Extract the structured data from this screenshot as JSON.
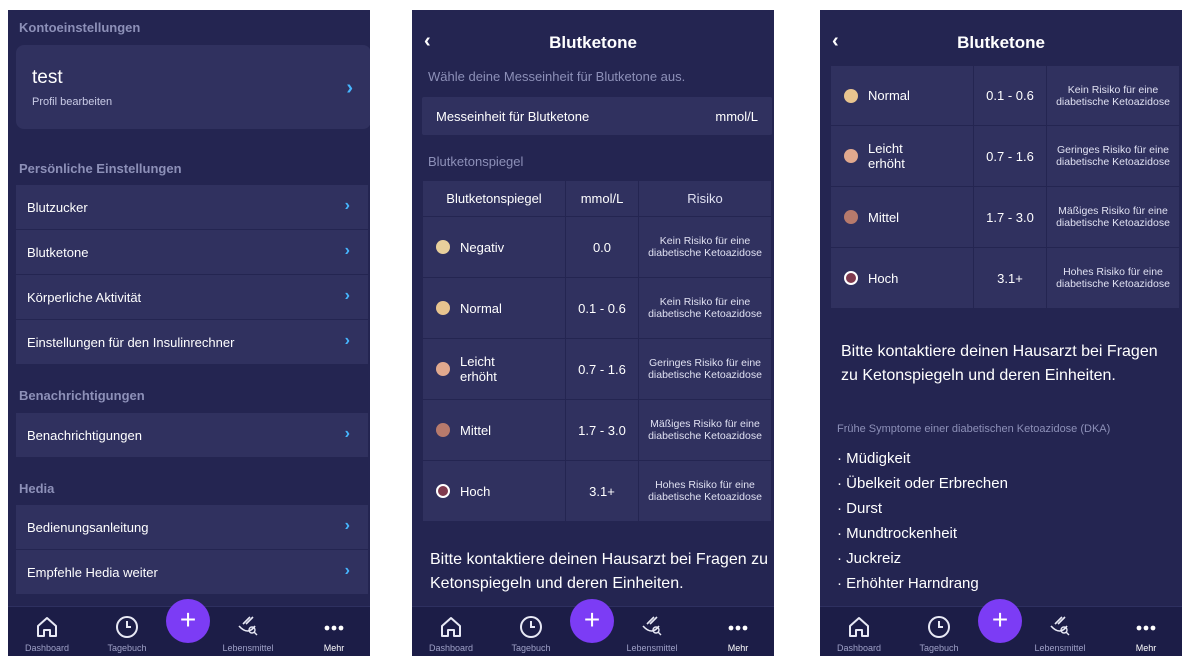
{
  "screen1": {
    "account_header": "Kontoeinstellungen",
    "profile_name": "test",
    "profile_sub": "Profil bearbeiten",
    "personal_header": "Persönliche Einstellungen",
    "personal_items": [
      "Blutzucker",
      "Blutketone",
      "Körperliche Aktivität",
      "Einstellungen für den Insulinrechner"
    ],
    "notif_header": "Benachrichtigungen",
    "notif_items": [
      "Benachrichtigungen"
    ],
    "hedia_header": "Hedia",
    "hedia_items": [
      "Bedienungsanleitung",
      "Empfehle Hedia weiter"
    ]
  },
  "screen2": {
    "title": "Blutketone",
    "intro": "Wähle deine Messeinheit für Blutketone aus.",
    "unit_label": "Messeinheit für Blutketone",
    "unit_value": "mmol/L",
    "table_header_section": "Blutketonspiegel",
    "columns": [
      "Blutketonspiegel",
      "mmol/L",
      "Risiko"
    ],
    "rows": [
      {
        "level": "Negativ",
        "value": "0.0",
        "risk": "Kein Risiko für eine diabetische Ketoazidose",
        "color": "#e8cf9c"
      },
      {
        "level": "Normal",
        "value": "0.1 - 0.6",
        "risk": "Kein Risiko für eine diabetische Ketoazidose",
        "color": "#e8c48f"
      },
      {
        "level": "Leicht erhöht",
        "value": "0.7 - 1.6",
        "risk": "Geringes Risiko für eine diabetische Ketoazidose",
        "color": "#e1a98e"
      },
      {
        "level": "Mittel",
        "value": "1.7 - 3.0",
        "risk": "Mäßiges Risiko für eine diabetische Ketoazidose",
        "color": "#b77a6c"
      },
      {
        "level": "Hoch",
        "value": "3.1+",
        "risk": "Hohes Risiko für eine diabetische Ketoazidose",
        "color": "#7f3a4e"
      }
    ],
    "note": "Bitte kontaktiere deinen Hausarzt bei Fragen zu Ketonspiegeln und deren Einheiten."
  },
  "screen3": {
    "title": "Blutketone",
    "rows": [
      {
        "level": "Normal",
        "value": "0.1 - 0.6",
        "risk": "Kein Risiko für eine diabetische Ketoazidose",
        "color": "#e8c48f"
      },
      {
        "level": "Leicht erhöht",
        "value": "0.7 - 1.6",
        "risk": "Geringes Risiko für eine diabetische Ketoazidose",
        "color": "#e1a98e"
      },
      {
        "level": "Mittel",
        "value": "1.7 - 3.0",
        "risk": "Mäßiges Risiko für eine diabetische Ketoazidose",
        "color": "#b77a6c"
      },
      {
        "level": "Hoch",
        "value": "3.1+",
        "risk": "Hohes Risiko für eine diabetische Ketoazidose",
        "color": "#7f3a4e"
      }
    ],
    "note": "Bitte kontaktiere deinen Hausarzt bei Fragen zu Ketonspiegeln und deren Einheiten.",
    "dka_title": "Frühe Symptome einer diabetischen Ketoazidose (DKA)",
    "symptoms": [
      "· Müdigkeit",
      "· Übelkeit oder Erbrechen",
      "· Durst",
      "· Mundtrockenheit",
      "· Juckreiz",
      "· Erhöhter Harndrang"
    ]
  },
  "nav": {
    "items": [
      "Dashboard",
      "Tagebuch",
      "Lebensmittel",
      "Mehr"
    ],
    "add_symbol": "+",
    "accent": "#7c3cf5",
    "active": "Mehr"
  },
  "icons": {
    "back": "‹",
    "chevron": "›"
  },
  "colors": {
    "background": "#242551",
    "card": "#30315f",
    "link": "#46b6ff"
  }
}
